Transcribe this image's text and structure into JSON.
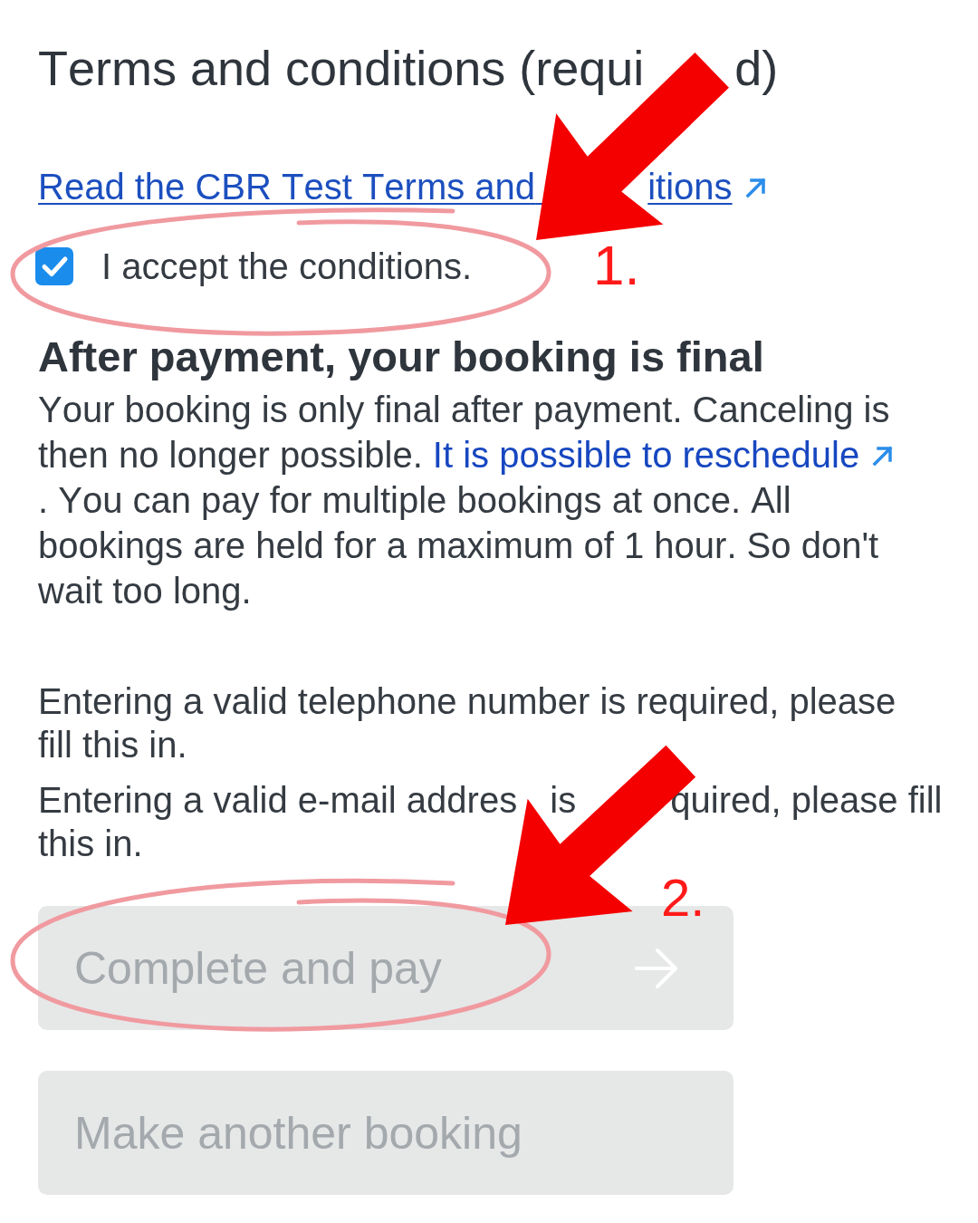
{
  "terms": {
    "title_parts": [
      "Terms and conditions (requi",
      "d)"
    ],
    "link_parts": [
      "Read the CBR Test Terms and",
      "itions"
    ],
    "accept": {
      "label": "I accept the conditions.",
      "checked": true
    }
  },
  "notice": {
    "heading": "After payment, your booking is final",
    "text_before": "Your booking is only final after payment. Canceling is then no longer possible. ",
    "link": "It is possible to reschedule",
    "text_after": ". You can pay for multiple bookings at once. All bookings are held for a maximum of 1 hour. So don't wait too long."
  },
  "errors": [
    {
      "parts": [
        "Entering a valid telephone number is required, please fill this in."
      ]
    },
    {
      "parts": [
        "Entering a valid e-mail addres",
        "is",
        "quired, please fill this in."
      ]
    }
  ],
  "buttons": [
    {
      "label": "Complete and pay",
      "kind": "next",
      "disabled": true
    },
    {
      "label": "Make another booking",
      "kind": "plain",
      "disabled": true
    }
  ],
  "annotations": [
    {
      "number": "1."
    },
    {
      "number": "2."
    }
  ]
}
